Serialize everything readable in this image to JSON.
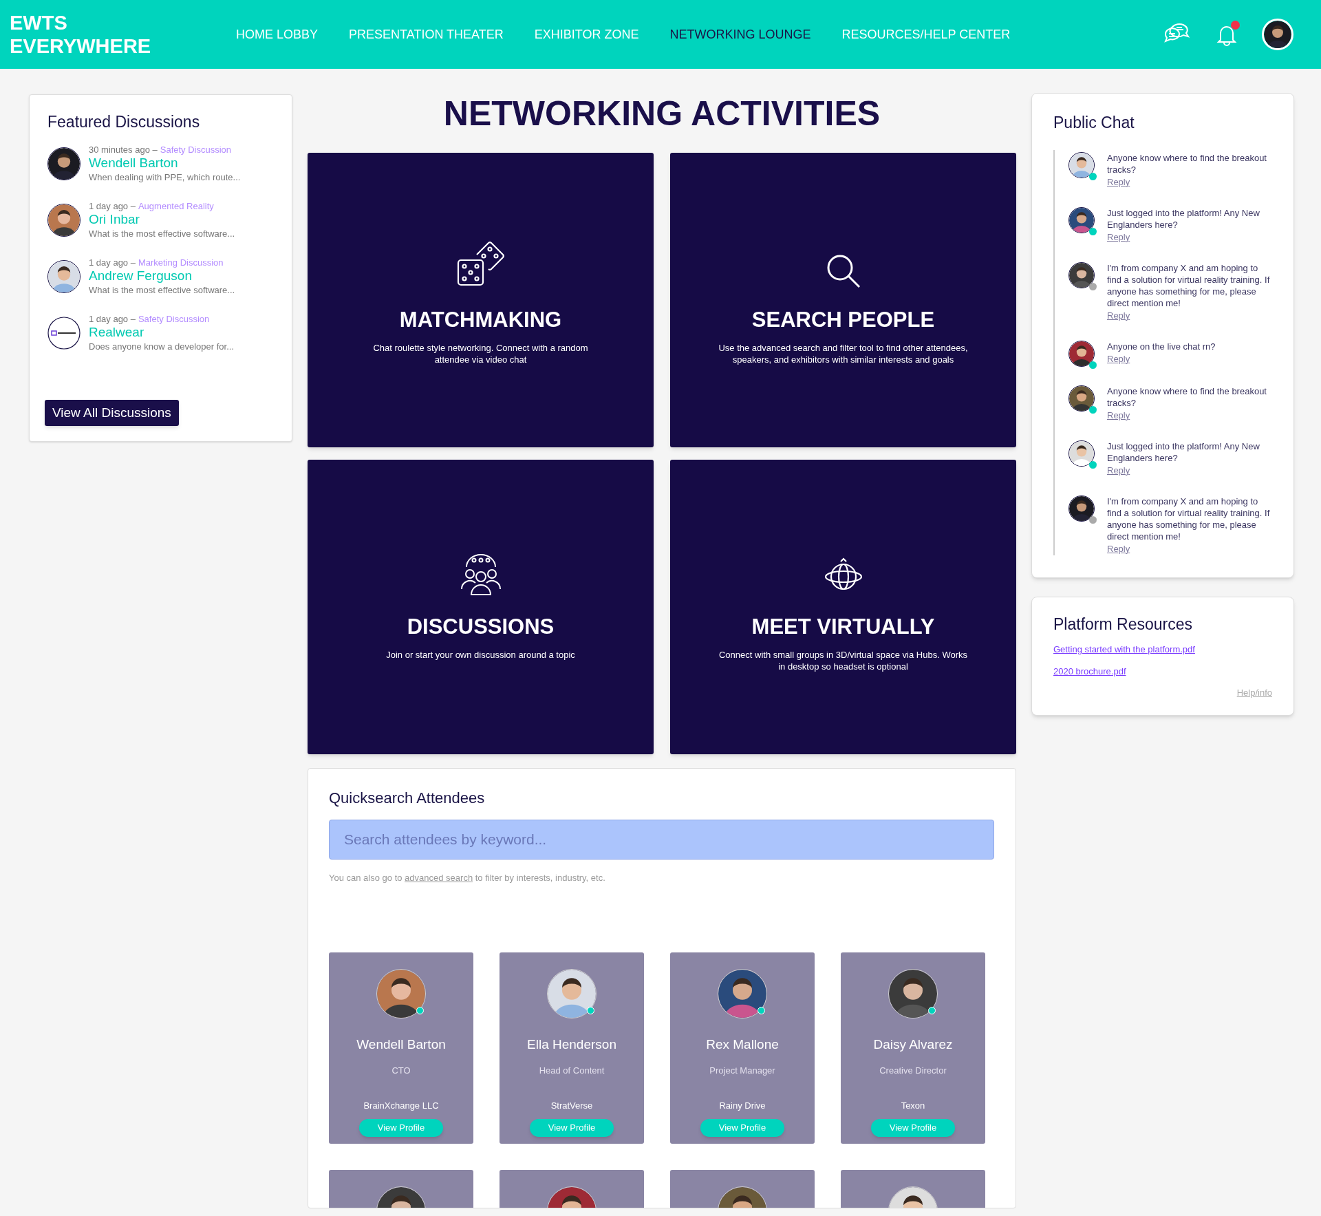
{
  "header": {
    "logo": [
      "EWTS",
      "EVERYWHERE"
    ],
    "nav": [
      {
        "label": "HOME LOBBY",
        "selected": false
      },
      {
        "label": "PRESENTATION THEATER",
        "selected": false
      },
      {
        "label": "EXHIBITOR ZONE",
        "selected": false
      },
      {
        "label": "NETWORKING LOUNGE",
        "selected": true
      },
      {
        "label": "RESOURCES/HELP CENTER",
        "selected": false
      }
    ],
    "notifications_unread": true
  },
  "featured_discussions": {
    "title": "Featured Discussions",
    "items": [
      {
        "time": "30 minutes ago –",
        "topic": "Safety Discussion",
        "name": "Wendell Barton",
        "excerpt": "When dealing with PPE, which route...",
        "kind": "person"
      },
      {
        "time": "1 day ago –",
        "topic": "Augmented Reality",
        "name": "Ori Inbar",
        "excerpt": "What is the most effective software...",
        "kind": "person"
      },
      {
        "time": "1 day ago –",
        "topic": "Marketing Discussion",
        "name": "Andrew Ferguson",
        "excerpt": "What is the most effective software...",
        "kind": "person"
      },
      {
        "time": "1 day ago –",
        "topic": "Safety Discussion",
        "name": "Realwear",
        "excerpt": "Does anyone know a developer for...",
        "kind": "company"
      }
    ],
    "button": "View All Discussions"
  },
  "activities": {
    "title": "NETWORKING ACTIVITIES",
    "tiles": [
      {
        "kind": "dice",
        "title": "MATCHMAKING",
        "description": "Chat roulette style networking. Connect with a random attendee via video chat"
      },
      {
        "kind": "search",
        "title": "SEARCH PEOPLE",
        "description": "Use the advanced search and filter tool to find other attendees, speakers, and exhibitors with similar interests and goals"
      },
      {
        "kind": "group",
        "title": "DISCUSSIONS",
        "description": "Join or start your own discussion around a topic"
      },
      {
        "kind": "globe",
        "title": "MEET VIRTUALLY",
        "description": "Connect with small groups in 3D/virtual space via Hubs. Works in desktop so headset is optional"
      }
    ]
  },
  "quicksearch": {
    "title": "Quicksearch Attendees",
    "placeholder": "Search attendees by keyword...",
    "hint_before": "You can also go to",
    "hint_link": "advanced search",
    "hint_after": "to filter by interests, industry, etc.",
    "attendees": [
      {
        "name": "Wendell Barton",
        "role": "CTO",
        "company": "BrainXchange LLC",
        "online": true,
        "button": "View Profile"
      },
      {
        "name": "Ella Henderson",
        "role": "Head of Content",
        "company": "StratVerse",
        "online": true,
        "button": "View Profile"
      },
      {
        "name": "Rex Mallone",
        "role": "Project Manager",
        "company": "Rainy Drive",
        "online": true,
        "button": "View Profile"
      },
      {
        "name": "Daisy Alvarez",
        "role": "Creative Director",
        "company": "Texon",
        "online": true,
        "button": "View Profile"
      }
    ]
  },
  "public_chat": {
    "title": "Public Chat",
    "messages": [
      {
        "text": "Anyone know where to find the breakout tracks?",
        "online": true,
        "reply": "Reply"
      },
      {
        "text": "Just logged into the platform! Any New Englanders here?",
        "online": true,
        "reply": "Reply"
      },
      {
        "text": "I'm from company X and am hoping to find a solution for virtual reality training. If anyone has something for me, please direct mention me!",
        "online": false,
        "reply": "Reply"
      },
      {
        "text": "Anyone on the live chat rn?",
        "online": true,
        "reply": "Reply"
      },
      {
        "text": "Anyone know where to find the breakout tracks?",
        "online": true,
        "reply": "Reply"
      },
      {
        "text": "Just logged into the platform! Any New Englanders here?",
        "online": true,
        "reply": "Reply"
      },
      {
        "text": "I'm from company X and am hoping to find a solution for virtual reality training. If anyone has something for me, please direct mention me!",
        "online": false,
        "reply": "Reply"
      }
    ]
  },
  "platform_resources": {
    "title": "Platform Resources",
    "links": [
      "Getting started with the platform.pdf",
      "2020 brochure.pdf"
    ],
    "help": "Help/info"
  }
}
